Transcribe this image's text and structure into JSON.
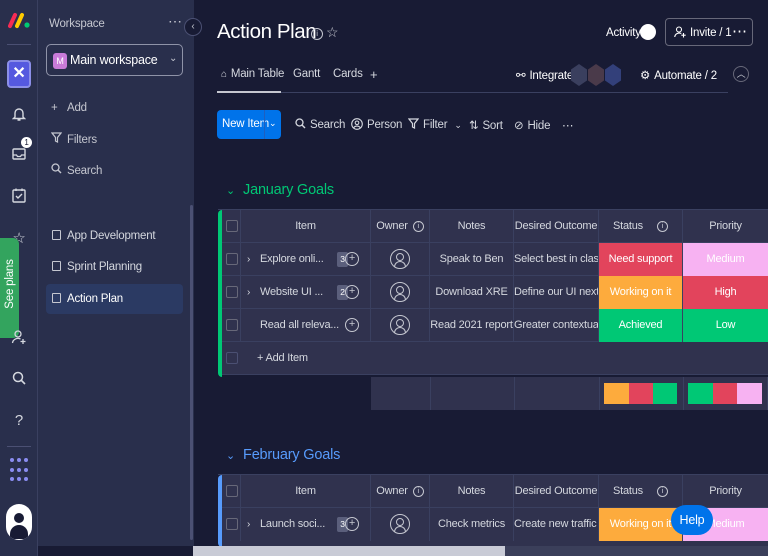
{
  "rail": {
    "see_plans": "See plans",
    "notification_badge": "1",
    "logo_colors": [
      "#f62b54",
      "#ffcb00",
      "#00ca72"
    ]
  },
  "sidebar": {
    "header": "Workspace",
    "more": "⋯",
    "workspace_initial": "M",
    "workspace_name": "Main workspace",
    "actions": [
      {
        "icon": "plus-icon",
        "label": "Add"
      },
      {
        "icon": "filter-icon",
        "label": "Filters"
      },
      {
        "icon": "search-icon",
        "label": "Search"
      }
    ],
    "boards": [
      {
        "label": "App Development"
      },
      {
        "label": "Sprint Planning"
      },
      {
        "label": "Action Plan",
        "active": true
      }
    ]
  },
  "header": {
    "title": "Action Plan",
    "activity": "Activity",
    "invite": "Invite / 1",
    "tabs": [
      "Main Table",
      "Gantt",
      "Cards",
      "+"
    ],
    "integrate": "Integrate",
    "automate": "Automate / 2"
  },
  "toolbar": {
    "new_item": "New Item",
    "search": "Search",
    "person": "Person",
    "filter": "Filter",
    "sort": "Sort",
    "hide": "Hide",
    "more": "⋯"
  },
  "columns": [
    "Item",
    "Owner",
    "Notes",
    "Desired Outcome",
    "Status",
    "Priority"
  ],
  "groups": [
    {
      "name": "January Goals",
      "color": "#00c875",
      "rows": [
        {
          "item": "Explore onli...",
          "subitems": "3",
          "notes": "Speak to Ben",
          "outcome": "Select best in class ...",
          "status": "Need support",
          "status_color": "#e2445c",
          "priority": "Medium",
          "priority_color": "#f7b2f2"
        },
        {
          "item": "Website UI ...",
          "subitems": "2",
          "notes": "Download XRE",
          "outcome": "Define our UI next s...",
          "status": "Working on it",
          "status_color": "#fdab3d",
          "priority": "High",
          "priority_color": "#e2445c"
        },
        {
          "item": "Read all releva...",
          "subitems": "",
          "notes": "Read 2021 report",
          "outcome": "Greater contextual ...",
          "status": "Achieved",
          "status_color": "#00c875",
          "priority": "Low",
          "priority_color": "#00c875"
        }
      ],
      "add_item": "+ Add Item",
      "status_summary": [
        "#fdab3d",
        "#e2445c",
        "#00c875"
      ],
      "priority_summary": [
        "#00c875",
        "#e2445c",
        "#f7b2f2"
      ]
    },
    {
      "name": "February Goals",
      "color": "#579bfc",
      "rows": [
        {
          "item": "Launch soci...",
          "subitems": "3",
          "notes": "Check metrics",
          "outcome": "Create new traffic s...",
          "status": "Working on it",
          "status_color": "#fdab3d",
          "priority": "Medium",
          "priority_color": "#f7b2f2"
        }
      ]
    }
  ],
  "help": "Help"
}
